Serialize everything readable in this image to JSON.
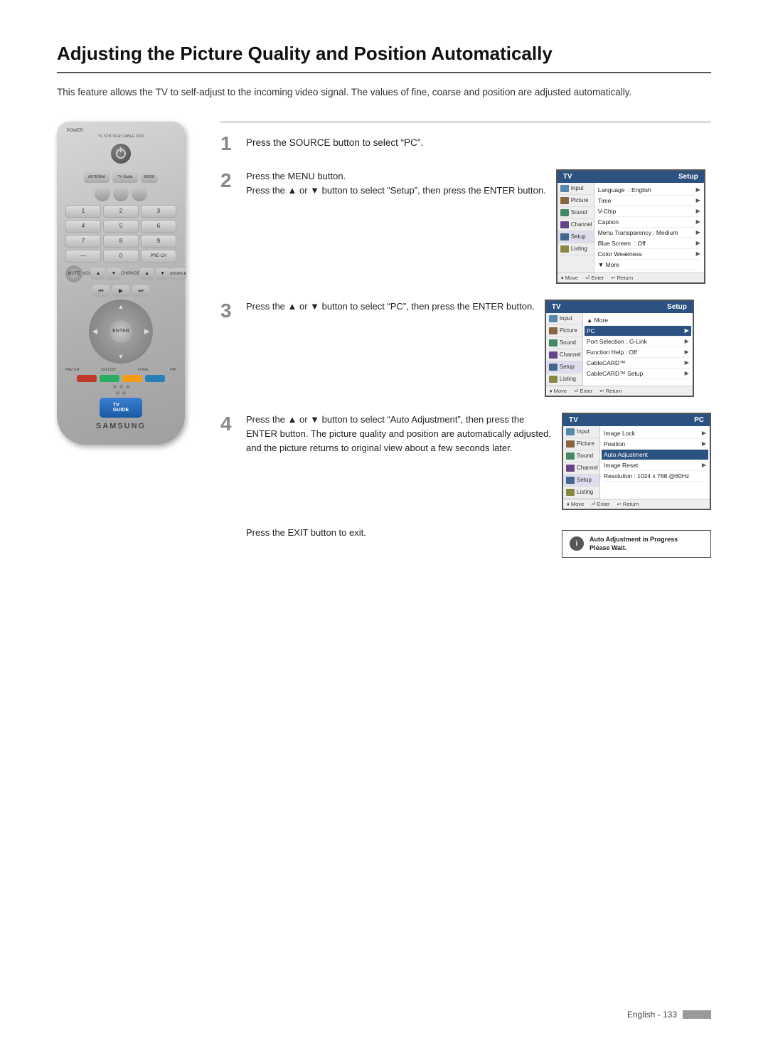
{
  "page": {
    "title": "Adjusting the Picture Quality and Position Automatically",
    "intro": "This feature allows the TV to self-adjust to the incoming video signal. The values of fine, coarse and position are adjusted automatically.",
    "page_number": "English - 133"
  },
  "steps": [
    {
      "number": "1",
      "text": "Press the SOURCE button to select “PC”."
    },
    {
      "number": "2",
      "text_line1": "Press the MENU button.",
      "text_line2": "Press the ▲ or ▼ button to select “Setup”, then press the ENTER button."
    },
    {
      "number": "3",
      "text_line1": "Press the ▲ or ▼ button to select “PC”, then press the ENTER button."
    },
    {
      "number": "4",
      "text": "Press the ▲ or ▼ button to select “Auto Adjustment”, then press the ENTER button. The picture quality and position are automatically adjusted, and the picture returns to original view about a few seconds later."
    }
  ],
  "exit_step": {
    "text": "Press the EXIT button to exit."
  },
  "screen1": {
    "header": "Setup",
    "sidebar": [
      {
        "label": "Input",
        "type": "input"
      },
      {
        "label": "Picture",
        "type": "picture"
      },
      {
        "label": "Sound",
        "type": "sound"
      },
      {
        "label": "Channel",
        "type": "channel"
      },
      {
        "label": "Setup",
        "type": "setup",
        "active": true
      },
      {
        "label": "Listing",
        "type": "listing"
      }
    ],
    "menu_items": [
      {
        "label": "Language",
        "value": ": English",
        "arrow": true
      },
      {
        "label": "Time",
        "arrow": true
      },
      {
        "label": "V-Chip",
        "arrow": true
      },
      {
        "label": "Caption",
        "arrow": true
      },
      {
        "label": "Menu Transparency",
        "value": ": Medium",
        "arrow": true
      },
      {
        "label": "Blue Screen",
        "value": ": Off",
        "arrow": true
      },
      {
        "label": "Color Weakness",
        "arrow": true
      },
      {
        "label": "▼ More"
      }
    ],
    "footer": "♦ Move  ✓Enter  ✓Return"
  },
  "screen2": {
    "header": "Setup",
    "sidebar": [
      {
        "label": "Input",
        "type": "input"
      },
      {
        "label": "Picture",
        "type": "picture"
      },
      {
        "label": "Sound",
        "type": "sound"
      },
      {
        "label": "Channel",
        "type": "channel"
      },
      {
        "label": "Setup",
        "type": "setup",
        "active": true
      },
      {
        "label": "Listing",
        "type": "listing"
      }
    ],
    "menu_items": [
      {
        "label": "▲ More"
      },
      {
        "label": "PC",
        "highlighted": true,
        "arrow": true
      },
      {
        "label": "Port Selection",
        "value": ": G-Link",
        "arrow": true
      },
      {
        "label": "Function Help",
        "value": ": Off",
        "arrow": true
      },
      {
        "label": "CableCARD™",
        "arrow": true
      },
      {
        "label": "CableCARD™ Setup",
        "arrow": true
      }
    ],
    "footer": "♦ Move  ✓Enter  ✓Return"
  },
  "screen3": {
    "header": "PC",
    "sidebar": [
      {
        "label": "Input",
        "type": "input"
      },
      {
        "label": "Picture",
        "type": "picture"
      },
      {
        "label": "Sound",
        "type": "sound"
      },
      {
        "label": "Channel",
        "type": "channel"
      },
      {
        "label": "Setup",
        "type": "setup",
        "active": true
      },
      {
        "label": "Listing",
        "type": "listing"
      }
    ],
    "menu_items": [
      {
        "label": "Image Lock",
        "arrow": true
      },
      {
        "label": "Position",
        "arrow": true
      },
      {
        "label": "Auto Adjustment",
        "highlighted": true
      },
      {
        "label": "Image Reset",
        "arrow": true
      },
      {
        "label": "Resolution",
        "value": ": 1024 x 768 @60Hz",
        "arrow": false
      }
    ],
    "footer": "♦ Move  ✓Enter  ✓Return"
  },
  "exit_box": {
    "icon": "i",
    "line1": "Auto Adjustment in Progress",
    "line2": "Please Wait."
  },
  "remote": {
    "brand": "SAMSUNG",
    "labels": {
      "antenna": "ANTENNA",
      "tv_guide": "TV Guide",
      "mode": "MODE",
      "power": "POWER",
      "tv_stb": "TV STB VCR CABLE DVD",
      "mute": "MUTE",
      "vol": "VOL",
      "chpage": "CH/PAGE",
      "source": "SOURCE",
      "fav_ch": "FAV CH",
      "ch_list": "CH LIST",
      "d_net": "D-Net",
      "pip": "PIP",
      "guide_label": "TV GUIDE"
    }
  }
}
